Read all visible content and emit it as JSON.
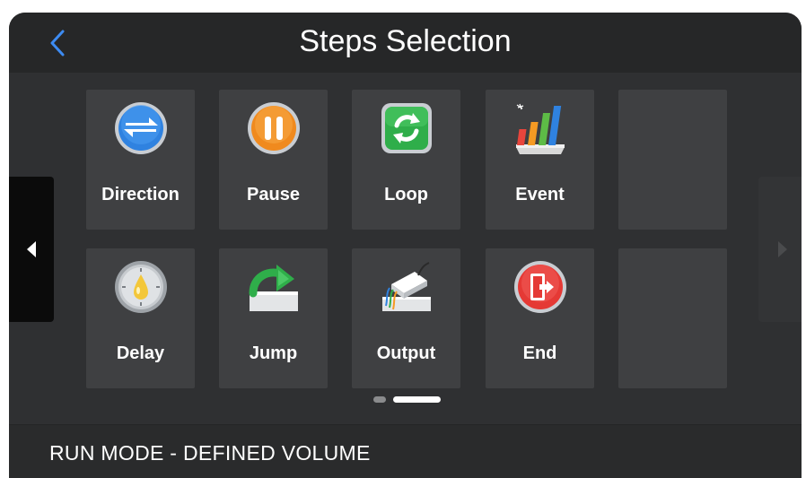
{
  "header": {
    "title": "Steps Selection",
    "back_icon": "chevron-left-icon",
    "back_color": "#3d8bf2"
  },
  "steps": {
    "row1": [
      {
        "label": "Direction",
        "icon": "direction-swap-icon"
      },
      {
        "label": "Pause",
        "icon": "pause-icon"
      },
      {
        "label": "Loop",
        "icon": "loop-refresh-icon"
      },
      {
        "label": "Event",
        "icon": "event-bar-chart-icon"
      },
      {
        "label": "",
        "icon": ""
      }
    ],
    "row2": [
      {
        "label": "Delay",
        "icon": "delay-timer-icon"
      },
      {
        "label": "Jump",
        "icon": "jump-arrow-icon"
      },
      {
        "label": "Output",
        "icon": "output-device-icon"
      },
      {
        "label": "End",
        "icon": "end-exit-icon"
      },
      {
        "label": "",
        "icon": ""
      }
    ]
  },
  "pager": {
    "pages": 2,
    "current": 2
  },
  "footer": {
    "status": "RUN  MODE - DEFINED VOLUME"
  },
  "colors": {
    "background": "#2e2f31",
    "tile": "#3f4042",
    "accent_blue": "#3d8bf2"
  }
}
